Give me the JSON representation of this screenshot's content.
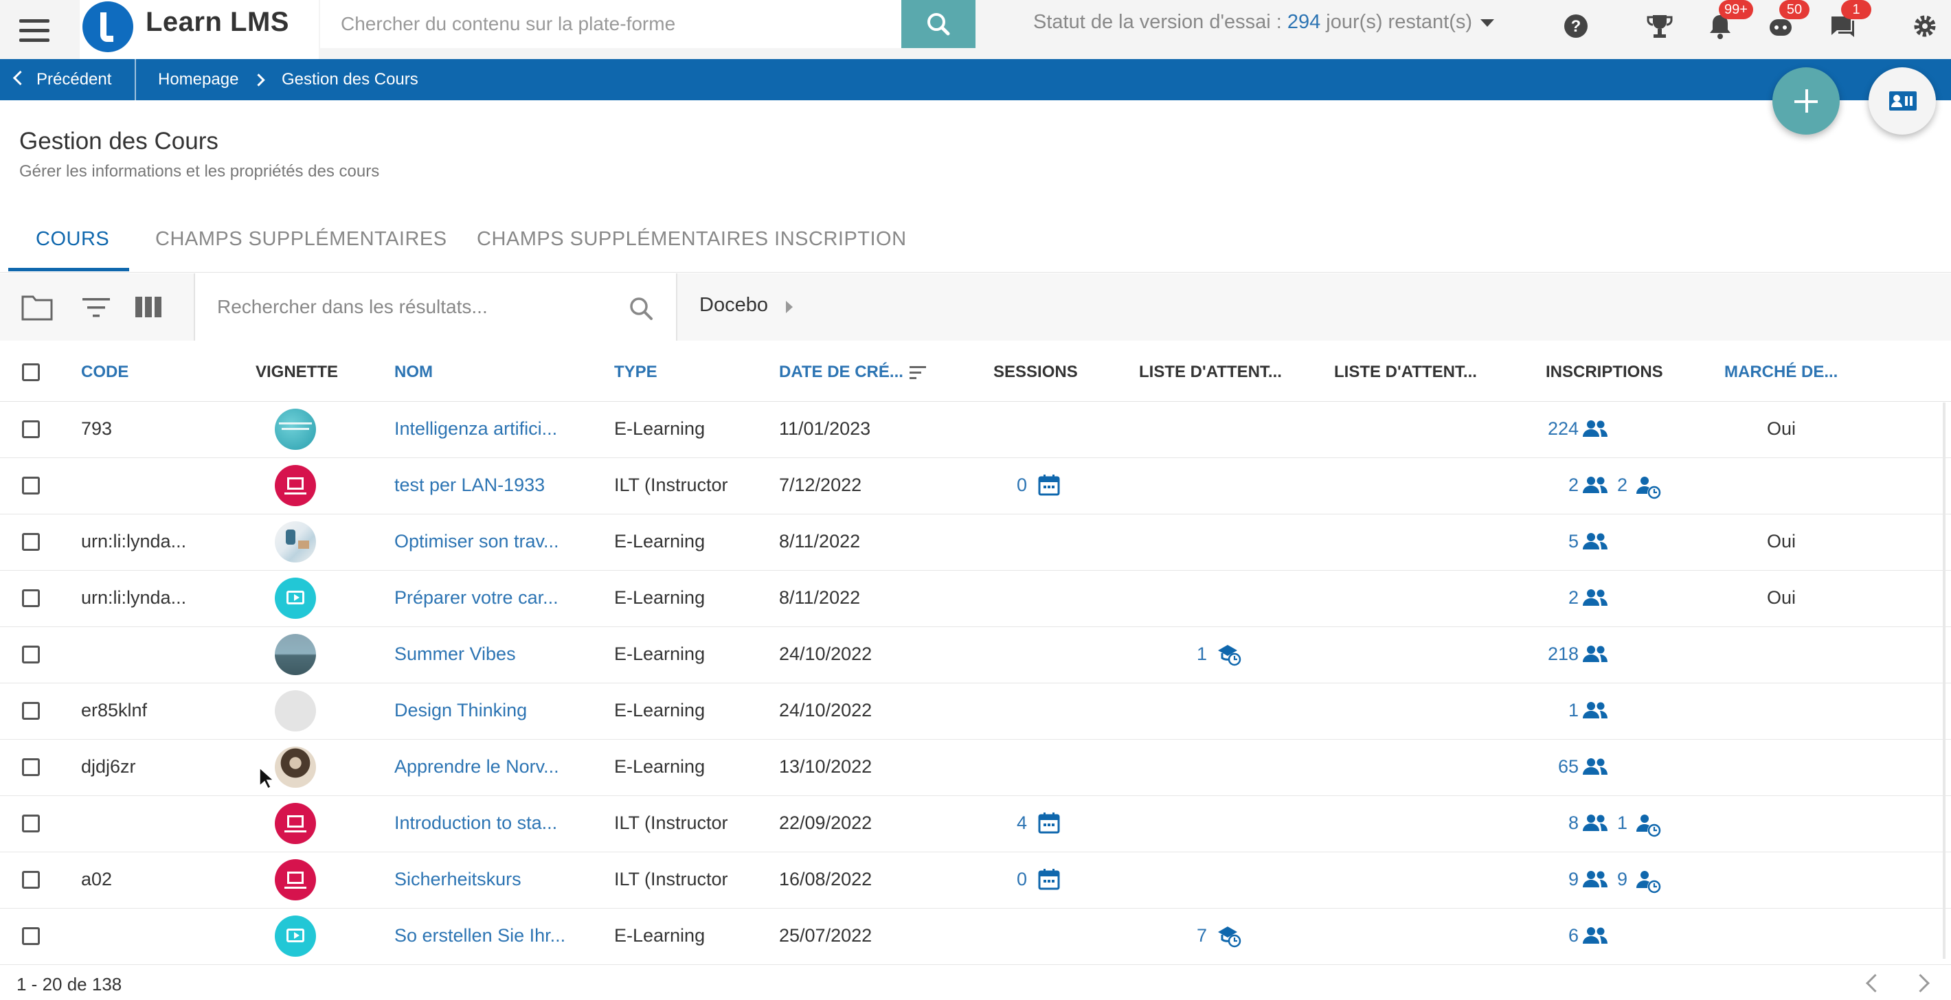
{
  "app": {
    "name": "Learn LMS",
    "search_placeholder": "Chercher du contenu sur la plate-forme",
    "trial_prefix": "Statut de la version d'essai : ",
    "trial_days": "294",
    "trial_suffix": " jour(s) restant(s)",
    "badges": {
      "notifications": "99+",
      "bot": "50",
      "messages": "1"
    }
  },
  "breadcrumb": {
    "back": "Précédent",
    "items": [
      "Homepage",
      "Gestion des Cours"
    ]
  },
  "page": {
    "title": "Gestion des Cours",
    "subtitle": "Gérer les informations et les propriétés des cours"
  },
  "tabs": [
    "COURS",
    "CHAMPS SUPPLÉMENTAIRES",
    "CHAMPS SUPPLÉMENTAIRES INSCRIPTION"
  ],
  "toolbar": {
    "search_placeholder": "Rechercher dans les résultats...",
    "catalog": "Docebo"
  },
  "columns": [
    "CODE",
    "VIGNETTE",
    "NOM",
    "TYPE",
    "DATE DE CRÉ...",
    "SESSIONS",
    "LISTE D'ATTENT...",
    "LISTE D'ATTENT...",
    "INSCRIPTIONS",
    "MARCHÉ DE..."
  ],
  "rows": [
    {
      "code": "793",
      "thumb": "ai-image",
      "name": "Intelligenza artifici...",
      "type": "E-Learning",
      "date": "11/01/2023",
      "sessions": "",
      "waitlist": "",
      "enrollments": "224",
      "pending": "",
      "market": "Oui"
    },
    {
      "code": "",
      "thumb": "ilt-icon",
      "name": "test per LAN-1933",
      "type": "ILT (Instructor",
      "date": "7/12/2022",
      "sessions": "0",
      "waitlist": "",
      "enrollments": "2",
      "pending": "2",
      "market": ""
    },
    {
      "code": "urn:li:lynda...",
      "thumb": "office-image",
      "name": "Optimiser son trav...",
      "type": "E-Learning",
      "date": "8/11/2022",
      "sessions": "",
      "waitlist": "",
      "enrollments": "5",
      "pending": "",
      "market": "Oui"
    },
    {
      "code": "urn:li:lynda...",
      "thumb": "video-icon",
      "name": "Préparer votre car...",
      "type": "E-Learning",
      "date": "8/11/2022",
      "sessions": "",
      "waitlist": "",
      "enrollments": "2",
      "pending": "",
      "market": "Oui"
    },
    {
      "code": "",
      "thumb": "beach-image",
      "name": "Summer Vibes",
      "type": "E-Learning",
      "date": "24/10/2022",
      "sessions": "",
      "waitlist": "1",
      "enrollments": "218",
      "pending": "",
      "market": ""
    },
    {
      "code": "er85klnf",
      "thumb": "blank-image",
      "name": "Design Thinking",
      "type": "E-Learning",
      "date": "24/10/2022",
      "sessions": "",
      "waitlist": "",
      "enrollments": "1",
      "pending": "",
      "market": ""
    },
    {
      "code": "djdj6zr",
      "thumb": "person-image",
      "name": "Apprendre le Norv...",
      "type": "E-Learning",
      "date": "13/10/2022",
      "sessions": "",
      "waitlist": "",
      "enrollments": "65",
      "pending": "",
      "market": ""
    },
    {
      "code": "",
      "thumb": "ilt-icon",
      "name": "Introduction to sta...",
      "type": "ILT (Instructor",
      "date": "22/09/2022",
      "sessions": "4",
      "waitlist": "",
      "enrollments": "8",
      "pending": "1",
      "market": ""
    },
    {
      "code": "a02",
      "thumb": "ilt-icon",
      "name": "Sicherheitskurs",
      "type": "ILT (Instructor",
      "date": "16/08/2022",
      "sessions": "0",
      "waitlist": "",
      "enrollments": "9",
      "pending": "9",
      "market": ""
    },
    {
      "code": "",
      "thumb": "video-icon",
      "name": "So erstellen Sie Ihr...",
      "type": "E-Learning",
      "date": "25/07/2022",
      "sessions": "",
      "waitlist": "7",
      "enrollments": "6",
      "pending": "",
      "market": ""
    }
  ],
  "pagination": "1 - 20 de 138",
  "colors": {
    "primary": "#0f67ad",
    "teal": "#5aa9ad",
    "link": "#2c74b3",
    "ilt": "#d6134d",
    "video": "#22c7d6"
  }
}
